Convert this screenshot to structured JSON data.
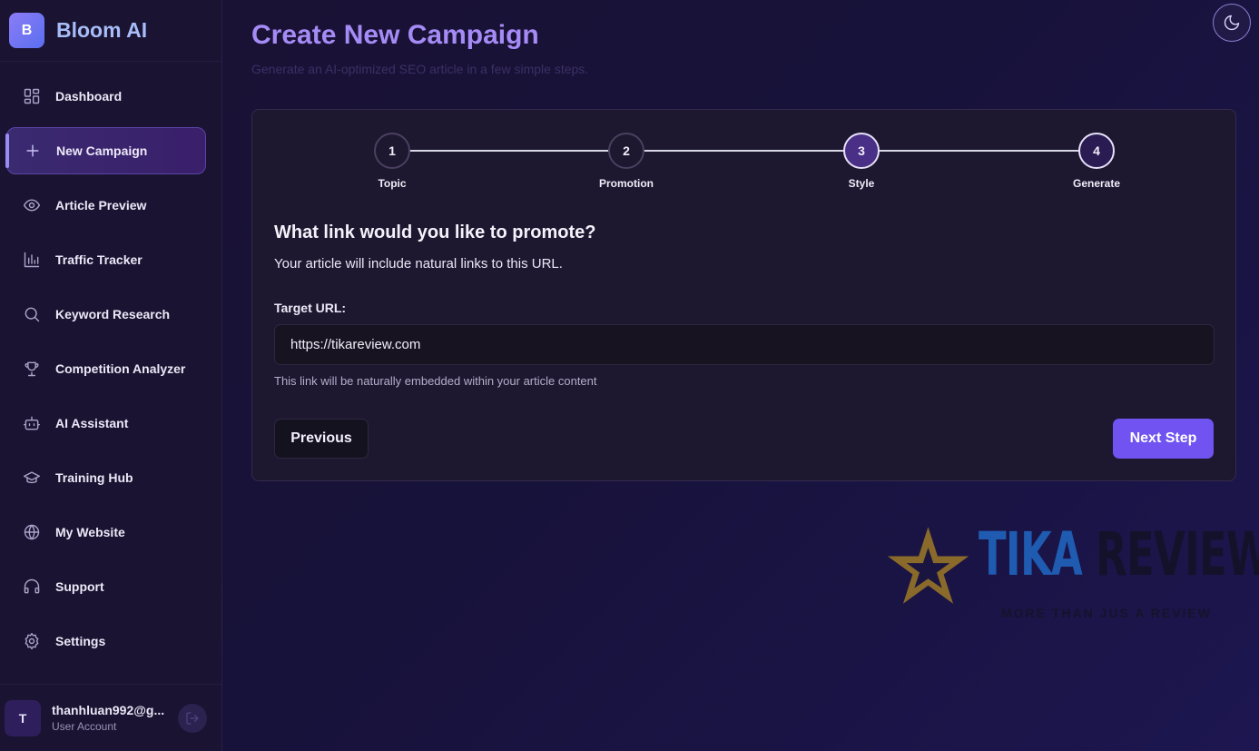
{
  "app": {
    "logo_letter": "B",
    "name": "Bloom AI"
  },
  "sidebar": {
    "items": [
      {
        "label": "Dashboard",
        "icon": "dashboard-icon",
        "active": false
      },
      {
        "label": "New Campaign",
        "icon": "plus-icon",
        "active": true
      },
      {
        "label": "Article Preview",
        "icon": "eye-icon",
        "active": false
      },
      {
        "label": "Traffic Tracker",
        "icon": "bar-chart-icon",
        "active": false
      },
      {
        "label": "Keyword Research",
        "icon": "search-icon",
        "active": false
      },
      {
        "label": "Competition Analyzer",
        "icon": "trophy-icon",
        "active": false
      },
      {
        "label": "AI Assistant",
        "icon": "bot-icon",
        "active": false
      },
      {
        "label": "Training Hub",
        "icon": "graduation-cap-icon",
        "active": false
      },
      {
        "label": "My Website",
        "icon": "globe-icon",
        "active": false
      },
      {
        "label": "Support",
        "icon": "headphones-icon",
        "active": false
      },
      {
        "label": "Settings",
        "icon": "gear-icon",
        "active": false
      }
    ]
  },
  "user": {
    "initial": "T",
    "email": "thanhluan992@g...",
    "role": "User Account"
  },
  "header": {
    "title": "Create New Campaign",
    "subtitle": "Generate an AI-optimized SEO article in a few simple steps."
  },
  "stepper": {
    "current_step": 3,
    "steps": [
      {
        "number": "1",
        "label": "Topic"
      },
      {
        "number": "2",
        "label": "Promotion"
      },
      {
        "number": "3",
        "label": "Style"
      },
      {
        "number": "4",
        "label": "Generate"
      }
    ]
  },
  "form": {
    "question": "What link would you like to promote?",
    "description": "Your article will include natural links to this URL.",
    "field_label": "Target URL:",
    "url_value": "https://tikareview.com",
    "hint": "This link will be naturally embedded within your article content",
    "prev_label": "Previous",
    "next_label": "Next Step"
  },
  "watermark": {
    "word1": "TIKA",
    "word2": "REVIEW",
    "tagline": "MORE THAN JUS A REVIEW"
  },
  "colors": {
    "accent": "#7053f0",
    "title": "#a58bf5",
    "brand": "#a8bdf7"
  }
}
